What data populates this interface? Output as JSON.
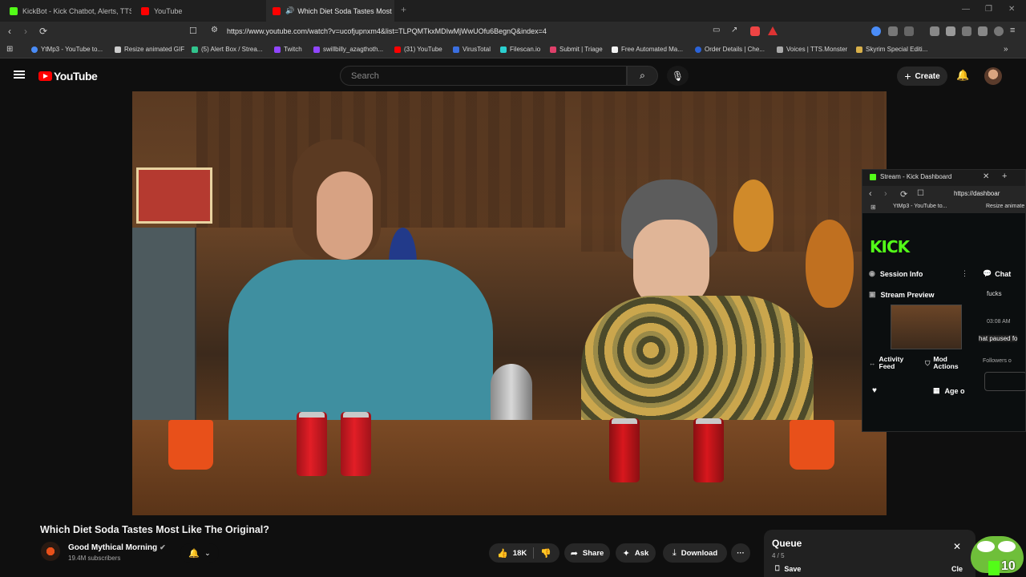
{
  "browser": {
    "tabs": [
      {
        "title": "KickBot - Kick Chatbot, Alerts, TTS, O",
        "active": false
      },
      {
        "title": "YouTube",
        "active": false
      },
      {
        "title": "Which Diet Soda Tastes Most",
        "active": true
      }
    ],
    "url": "https://www.youtube.com/watch?v=ucofjupnxm4&list=TLPQMTkxMDIwMjWwUOfu6BegnQ&index=4",
    "bookmarks": [
      "YtMp3 - YouTube to...",
      "Resize animated GIF",
      "(5) Alert Box / Strea...",
      "Twitch",
      "swillbilly_azagthoth...",
      "(31) YouTube",
      "VirusTotal",
      "Filescan.io",
      "Submit | Triage",
      "Free Automated Ma...",
      "Order Details | Che...",
      "Voices | TTS.Monster",
      "Skyrim Special Editi..."
    ]
  },
  "youtube": {
    "logo_text": "YouTube",
    "search_placeholder": "Search",
    "create_label": "Create"
  },
  "video": {
    "title": "Which Diet Soda Tastes Most Like The Original?",
    "channel": "Good Mythical Morning",
    "subscribers": "19.4M subscribers",
    "likes": "18K",
    "share_label": "Share",
    "ask_label": "Ask",
    "download_label": "Download",
    "more_label": "···"
  },
  "queue": {
    "title": "Queue",
    "count": "4 / 5",
    "save_label": "Save",
    "clear_label": "Cle"
  },
  "kick_window": {
    "tab_title": "Stream - Kick Dashboard",
    "url": "https://dashboar",
    "bookmark1": "YtMp3 - YouTube to...",
    "bookmark2": "Resize animate",
    "logo": "KICK",
    "session_info": "Session Info",
    "chat": "Chat",
    "stream_preview": "Stream Preview",
    "activity_feed": "Activity Feed",
    "mod_actions": "Mod Actions",
    "age": "Age o",
    "chat_msg1": "fucks",
    "chat_time": "03:08 AM",
    "chat_msg2": "hat paused fo",
    "followers": "Followers o"
  },
  "overlay": {
    "counter": "10"
  }
}
